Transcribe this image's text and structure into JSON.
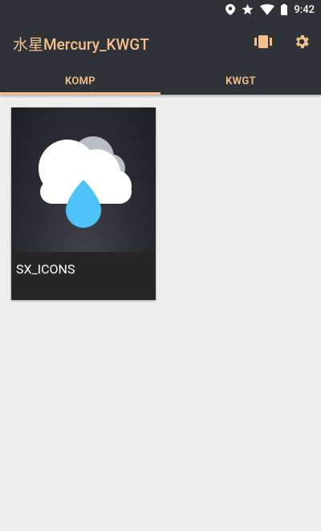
{
  "status_bar": {
    "time": "9:42",
    "icons": [
      "location-icon",
      "star-icon",
      "wifi-icon",
      "battery-icon"
    ]
  },
  "app_bar": {
    "title": "水星Mercury_KWGT",
    "actions": [
      "card-view-icon",
      "settings-gear-icon"
    ]
  },
  "tabs": [
    {
      "label": "KOMP",
      "selected": true
    },
    {
      "label": "KWGT",
      "selected": false
    }
  ],
  "items": [
    {
      "title": "SX_ICONS",
      "icon": "cloud-rain-drop-icon"
    }
  ],
  "colors": {
    "appbar_bg": "#2f3337",
    "accent": "#f4c08d",
    "background": "#eeeeee",
    "card_bg": "#262626",
    "drop": "#4fc3f7"
  }
}
